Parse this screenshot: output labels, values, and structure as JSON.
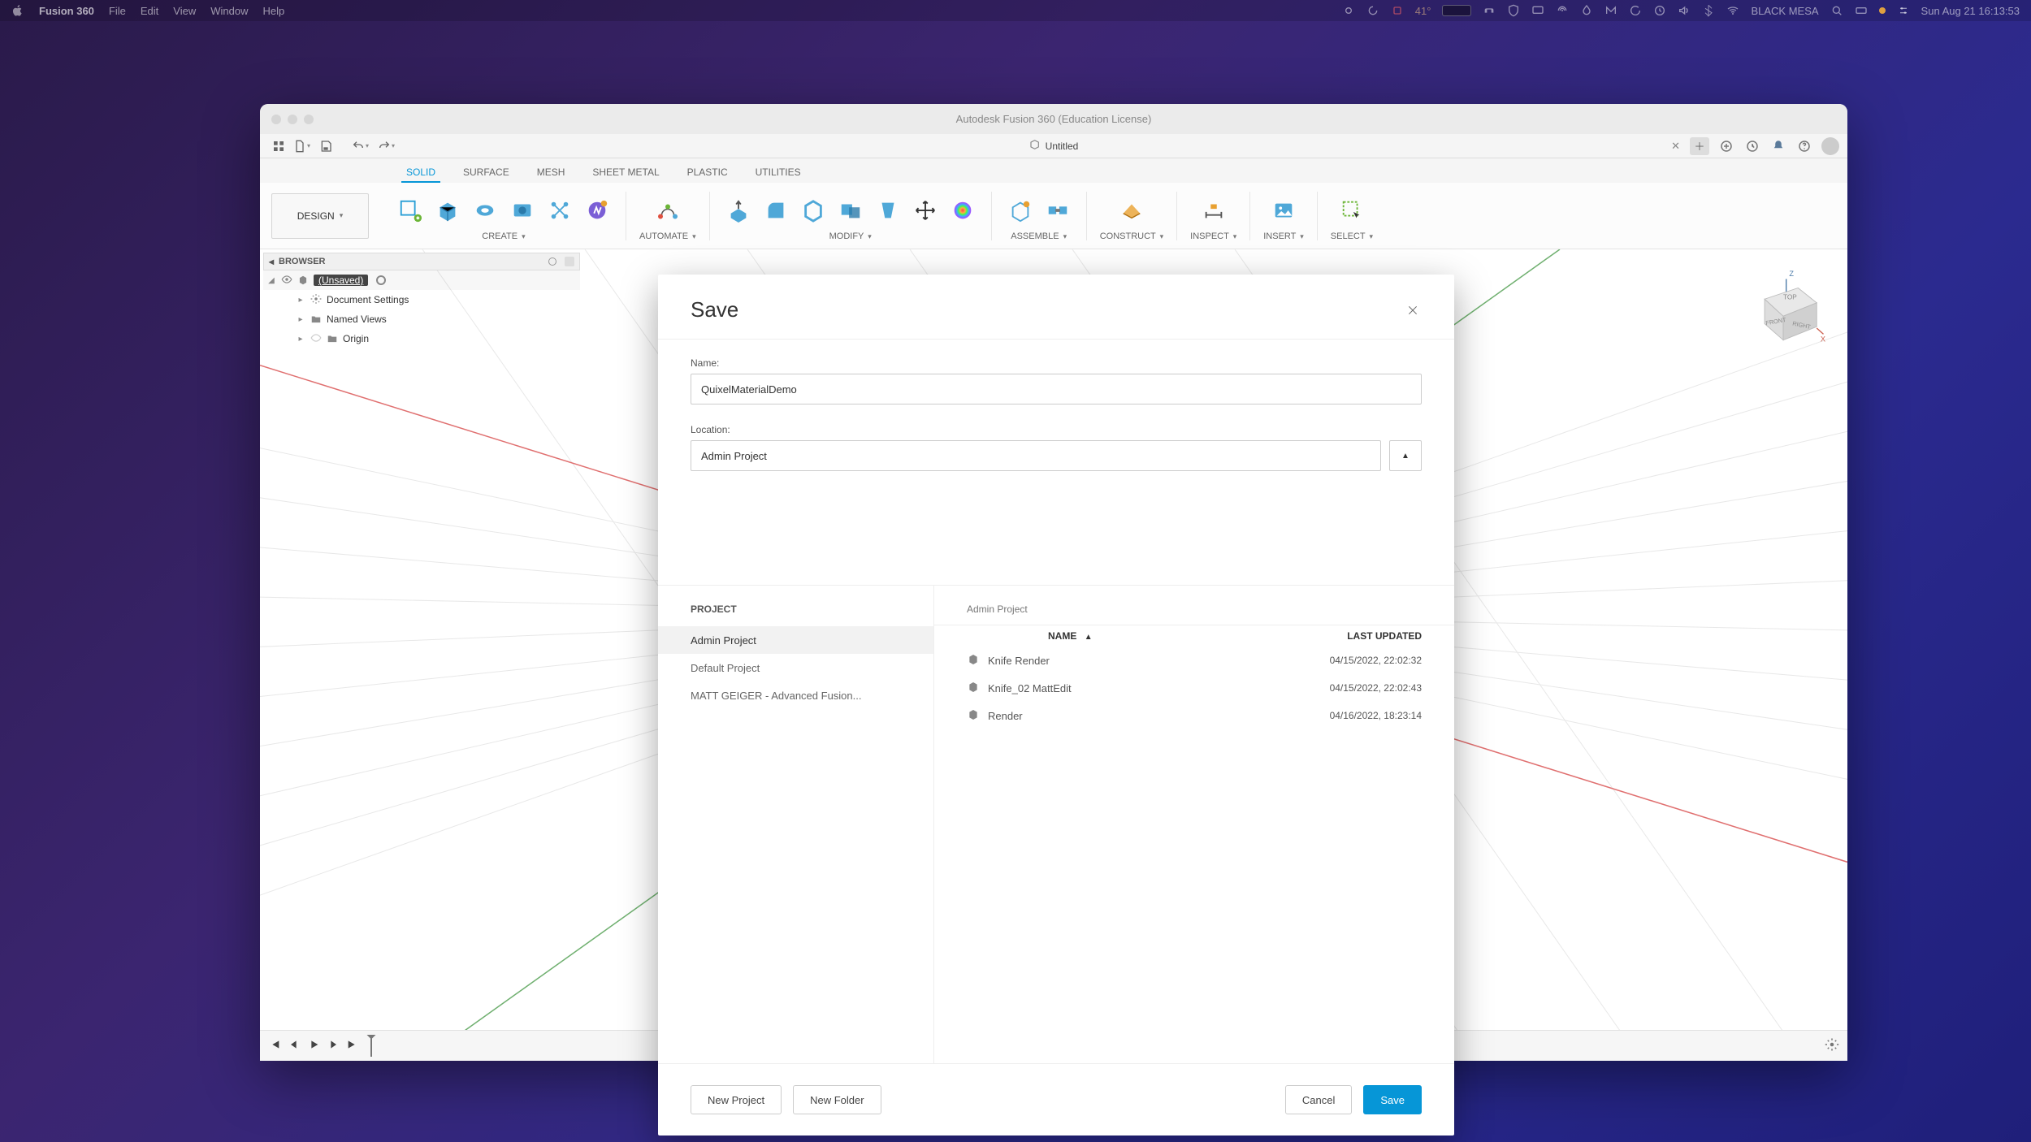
{
  "menubar": {
    "apple": "",
    "app_name": "Fusion 360",
    "items": [
      "File",
      "Edit",
      "View",
      "Window",
      "Help"
    ],
    "temperature": "41°",
    "hostname": "BLACK MESA",
    "datetime": "Sun Aug 21  16:13:53"
  },
  "window": {
    "title": "Autodesk Fusion 360 (Education License)",
    "tab_title": "Untitled"
  },
  "ribbon": {
    "workspace": "DESIGN",
    "tabs": [
      "SOLID",
      "SURFACE",
      "MESH",
      "SHEET METAL",
      "PLASTIC",
      "UTILITIES"
    ],
    "active_tab": "SOLID",
    "groups": {
      "create": "CREATE",
      "automate": "AUTOMATE",
      "modify": "MODIFY",
      "assemble": "ASSEMBLE",
      "construct": "CONSTRUCT",
      "inspect": "INSPECT",
      "insert": "INSERT",
      "select": "SELECT"
    }
  },
  "browser": {
    "header": "BROWSER",
    "root": "(Unsaved)",
    "items": [
      "Document Settings",
      "Named Views",
      "Origin"
    ]
  },
  "dialog": {
    "title": "Save",
    "name_label": "Name:",
    "name_value": "QuixelMaterialDemo",
    "location_label": "Location:",
    "location_value": "Admin Project",
    "section_project": "PROJECT",
    "projects": [
      "Admin Project",
      "Default Project",
      "MATT GEIGER - Advanced Fusion..."
    ],
    "breadcrumb": "Admin Project",
    "columns": {
      "name": "NAME",
      "date": "LAST UPDATED"
    },
    "files": [
      {
        "name": "Knife Render",
        "date": "04/15/2022, 22:02:32"
      },
      {
        "name": "Knife_02 MattEdit",
        "date": "04/15/2022, 22:02:43"
      },
      {
        "name": "Render",
        "date": "04/16/2022, 18:23:14"
      }
    ],
    "buttons": {
      "new_project": "New Project",
      "new_folder": "New Folder",
      "cancel": "Cancel",
      "save": "Save"
    }
  }
}
